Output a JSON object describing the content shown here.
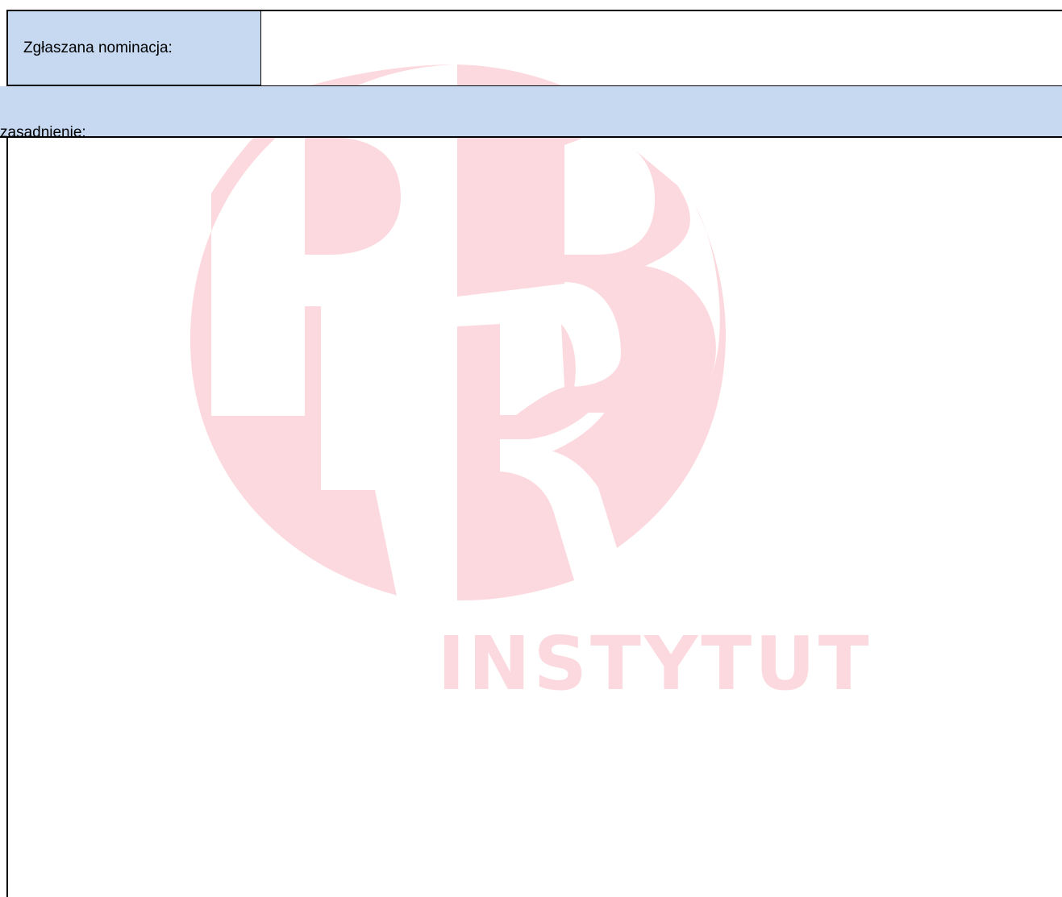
{
  "form": {
    "nomination_label": "Zgłaszana nominacja:",
    "nomination_value": "",
    "justification_label": "zasadnienie:",
    "justification_value": ""
  },
  "watermark": {
    "monogram": "PIB",
    "caption": "INSTYTUT",
    "color": "#fcd9de"
  }
}
